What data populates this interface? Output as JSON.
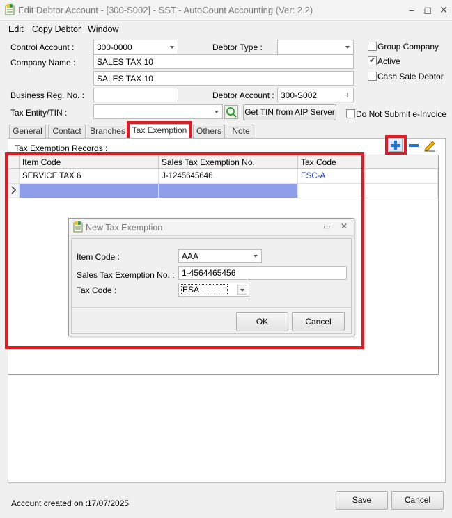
{
  "window": {
    "title": "Edit Debtor Account - [300-S002] - SST - AutoCount Accounting (Ver: 2.2)",
    "min_icon": "⎯",
    "max_icon": "◻",
    "close_icon": "✕"
  },
  "menu": {
    "edit": "Edit",
    "copy_debtor": "Copy Debtor",
    "window": "Window"
  },
  "form": {
    "control_account_label": "Control Account :",
    "control_account_value": "300-0000",
    "debtor_type_label": "Debtor Type :",
    "debtor_type_value": "",
    "company_name_label": "Company Name :",
    "company_name_value": "SALES TAX 10",
    "company_name2_value": "SALES TAX 10",
    "business_reg_label": "Business Reg. No. :",
    "business_reg_value": "",
    "debtor_account_label": "Debtor Account :",
    "debtor_account_value": "300-S002",
    "tax_entity_label": "Tax Entity/TIN :",
    "tax_entity_value": "",
    "get_tin_button": "Get TIN from AIP Server",
    "group_company_label": "Group Company",
    "active_label": "Active",
    "cash_sale_label": "Cash Sale Debtor",
    "no_einvoice_label": "Do Not Submit e-Invoice"
  },
  "tabs": [
    "General",
    "Contact",
    "Branches",
    "Tax Exemption",
    "Others",
    "Note"
  ],
  "records": {
    "title": "Tax Exemption Records :",
    "columns": [
      "Item Code",
      "Sales Tax Exemption No.",
      "Tax Code"
    ],
    "rows": [
      {
        "item_code": "SERVICE TAX 6",
        "exemption_no": "J-1245645646",
        "tax_code": "ESC-A"
      }
    ]
  },
  "dialog": {
    "title": "New Tax Exemption",
    "item_code_label": "Item Code :",
    "item_code_value": "AAA",
    "exemption_no_label": "Sales Tax Exemption No. :",
    "exemption_no_value": "1-4564465456",
    "tax_code_label": "Tax Code :",
    "tax_code_value": "ESA",
    "ok": "OK",
    "cancel": "Cancel"
  },
  "footer": {
    "created_label": "Account created on :",
    "created_value": "17/07/2025",
    "save": "Save",
    "cancel": "Cancel"
  },
  "colors": {
    "highlight_red": "#e01b24",
    "selection_blue": "#8e9ee8",
    "link_blue": "#1a3fcf"
  }
}
